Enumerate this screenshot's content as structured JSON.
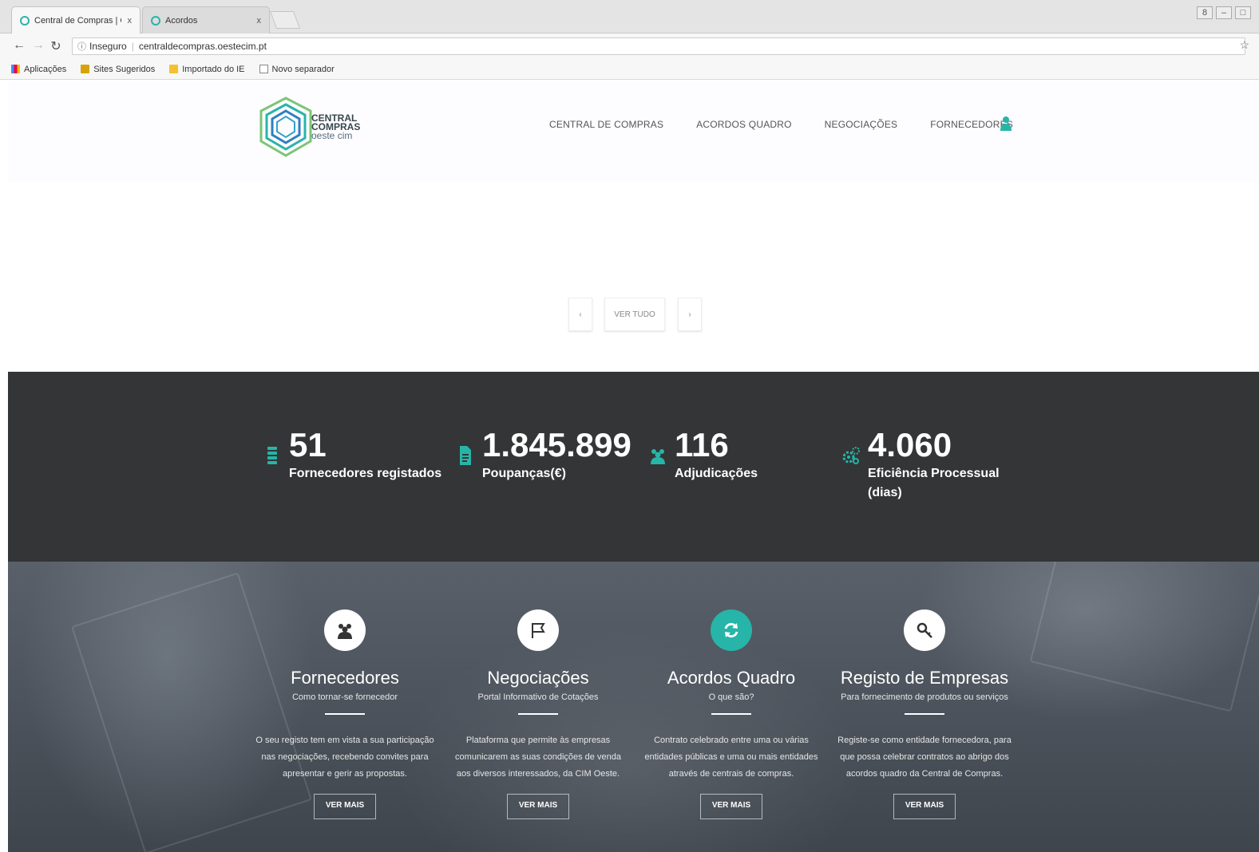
{
  "browser": {
    "tabs": [
      {
        "title": "Central de Compras | Cen",
        "close": "x"
      },
      {
        "title": "Acordos",
        "close": "x"
      }
    ],
    "window_controls": [
      "8",
      "–",
      "□"
    ],
    "url_security": "Inseguro",
    "url": "centraldecompras.oestecim.pt",
    "bookmarks": [
      "Aplicações",
      "Sites Sugeridos",
      "Importado do IE",
      "Novo separador"
    ]
  },
  "site": {
    "logo": {
      "line1": "CENTRAL",
      "line2": "COMPRAS",
      "line3": "oeste cim"
    },
    "nav": [
      "CENTRAL DE COMPRAS",
      "ACORDOS QUADRO",
      "NEGOCIAÇÕES",
      "FORNECEDORES"
    ],
    "pager": {
      "prev": "‹",
      "view_all": "VER TUDO",
      "next": "›"
    },
    "stats": [
      {
        "value": "51",
        "label": "Fornecedores registados",
        "icon": "database-icon"
      },
      {
        "value": "1.845.899",
        "label": "Poupanças(€)",
        "icon": "document-icon"
      },
      {
        "value": "116",
        "label": "Adjudicações",
        "icon": "users-icon"
      },
      {
        "value": "4.060",
        "label": "Eficiência Processual",
        "label2": "(dias)",
        "icon": "gears-icon"
      }
    ],
    "features": [
      {
        "title": "Fornecedores",
        "subtitle": "Como tornar-se fornecedor",
        "desc": "O seu registo tem em vista a sua participação nas negociações, recebendo convites para apresentar e gerir as propostas.",
        "button": "VER MAIS",
        "icon": "users-icon"
      },
      {
        "title": "Negociações",
        "subtitle": "Portal Informativo de Cotações",
        "desc": "Plataforma que permite às empresas comunicarem as suas condições de venda aos diversos interessados, da CIM Oeste.",
        "button": "VER MAIS",
        "icon": "flag-icon"
      },
      {
        "title": "Acordos Quadro",
        "subtitle": "O que são?",
        "desc": "Contrato celebrado entre uma ou várias entidades públicas e uma ou mais entidades através de centrais de compras.",
        "button": "VER MAIS",
        "icon": "refresh-icon"
      },
      {
        "title": "Registo de Empresas",
        "subtitle": "Para fornecimento de produtos ou serviços",
        "desc": "Registe-se como entidade fornecedora, para que possa celebrar contratos ao abrigo dos acordos quadro da Central de Compras.",
        "button": "VER MAIS",
        "icon": "key-icon"
      }
    ],
    "colors": {
      "accent": "#26b5a8",
      "stats_bg": "#333536"
    }
  }
}
